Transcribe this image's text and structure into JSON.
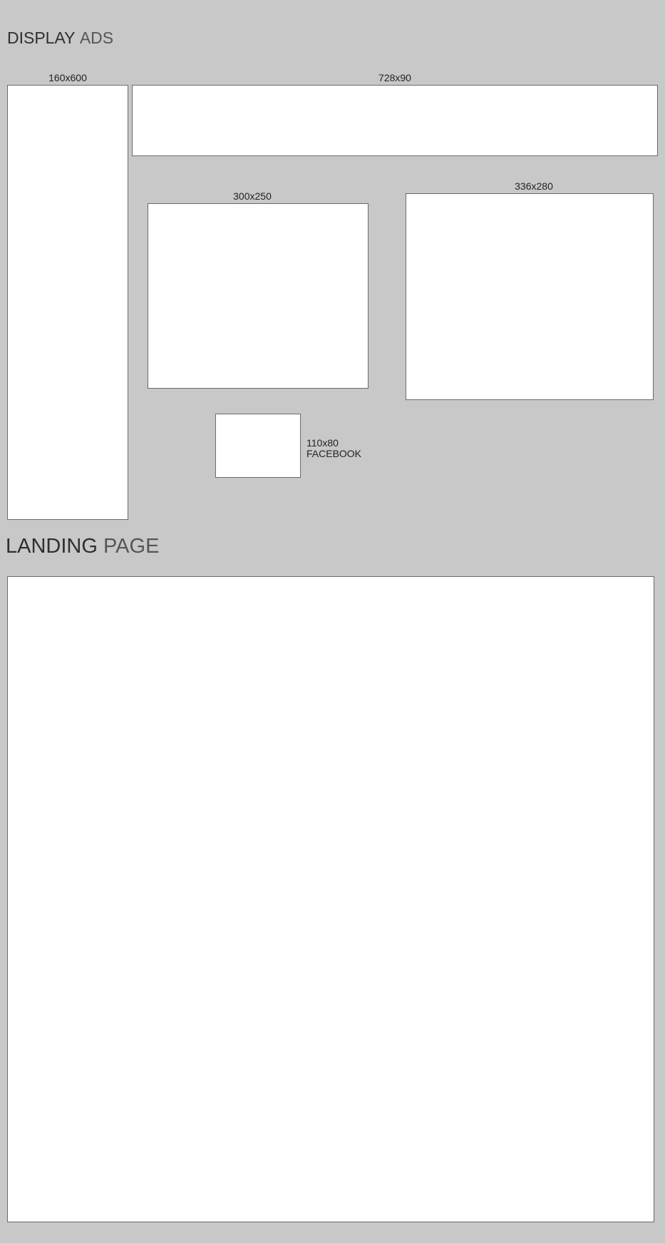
{
  "display_ads": {
    "title_strong": "DISPLAY",
    "title_light": "ADS",
    "ads": {
      "skyscraper": {
        "label": "160x600"
      },
      "leaderboard": {
        "label": "728x90"
      },
      "medium_rectangle": {
        "label": "300x250"
      },
      "large_rectangle": {
        "label": "336x280"
      },
      "facebook": {
        "size": "110x80",
        "platform": "FACEBOOK"
      }
    }
  },
  "landing_page": {
    "title_strong": "LANDING",
    "title_light": "PAGE"
  }
}
